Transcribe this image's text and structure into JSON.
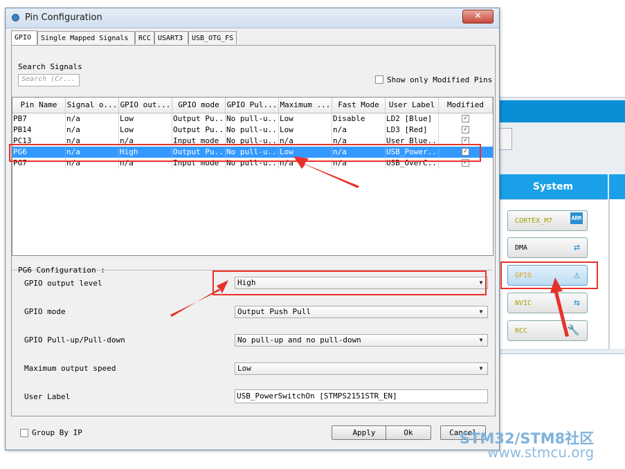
{
  "dialog": {
    "title": "Pin Configuration",
    "close_label": "✕"
  },
  "tabs": [
    "GPIO",
    "Single Mapped Signals",
    "RCC",
    "USART3",
    "USB_OTG_FS"
  ],
  "search": {
    "label": "Search Signals",
    "placeholder": "Search (Cr..."
  },
  "show_modified_label": "Show only Modified Pins",
  "table": {
    "headers": [
      "Pin Name",
      "Signal o...",
      "GPIO out...",
      "GPIO mode",
      "GPIO Pul...",
      "Maximum ...",
      "Fast Mode",
      "User Label",
      "Modified"
    ],
    "rows": [
      {
        "pin": "PB7",
        "signal": "n/a",
        "out": "Low",
        "mode": "Output Pu...",
        "pull": "No pull-u...",
        "max": "Low",
        "fast": "Disable",
        "label": "LD2 [Blue]",
        "modified": true,
        "selected": false
      },
      {
        "pin": "PB14",
        "signal": "n/a",
        "out": "Low",
        "mode": "Output Pu...",
        "pull": "No pull-u...",
        "max": "Low",
        "fast": "n/a",
        "label": "LD3 [Red]",
        "modified": true,
        "selected": false
      },
      {
        "pin": "PC13",
        "signal": "n/a",
        "out": "n/a",
        "mode": "Input mode",
        "pull": "No pull-u...",
        "max": "n/a",
        "fast": "n/a",
        "label": "User Blue...",
        "modified": true,
        "selected": false
      },
      {
        "pin": "PG6",
        "signal": "n/a",
        "out": "High",
        "mode": "Output Pu...",
        "pull": "No pull-u...",
        "max": "Low",
        "fast": "n/a",
        "label": "USB_Power...",
        "modified": true,
        "selected": true
      },
      {
        "pin": "PG7",
        "signal": "n/a",
        "out": "n/a",
        "mode": "Input mode",
        "pull": "No pull-u...",
        "max": "n/a",
        "fast": "n/a",
        "label": "USB_OverC...",
        "modified": true,
        "selected": false
      }
    ]
  },
  "config": {
    "title": "PG6 Configuration :",
    "output_level": {
      "label": "GPIO output level",
      "value": "High"
    },
    "mode": {
      "label": "GPIO mode",
      "value": "Output Push Pull"
    },
    "pull": {
      "label": "GPIO Pull-up/Pull-down",
      "value": "No pull-up and no pull-down"
    },
    "speed": {
      "label": "Maximum output speed",
      "value": "Low"
    },
    "user_label": {
      "label": "User Label",
      "value": "USB_PowerSwitchOn [STMPS2151STR_EN]"
    }
  },
  "footer": {
    "group_by_ip": "Group By IP",
    "apply": "Apply",
    "ok": "Ok",
    "cancel": "Cancel"
  },
  "system": {
    "header": "System",
    "buttons": [
      {
        "label": "CORTEX_M7",
        "icon": "arm-icon"
      },
      {
        "label": "DMA",
        "icon": "dma-icon"
      },
      {
        "label": "GPIO",
        "icon": "gpio-warning-icon"
      },
      {
        "label": "NVIC",
        "icon": "nvic-icon"
      },
      {
        "label": "RCC",
        "icon": "wrench-icon"
      }
    ]
  },
  "watermark": {
    "main": "STM32/STM8社区",
    "url": "www.stmcu.org"
  },
  "colors": {
    "selection": "#3399ff",
    "annotation": "#e8312a",
    "system_header": "#19a0e8"
  }
}
